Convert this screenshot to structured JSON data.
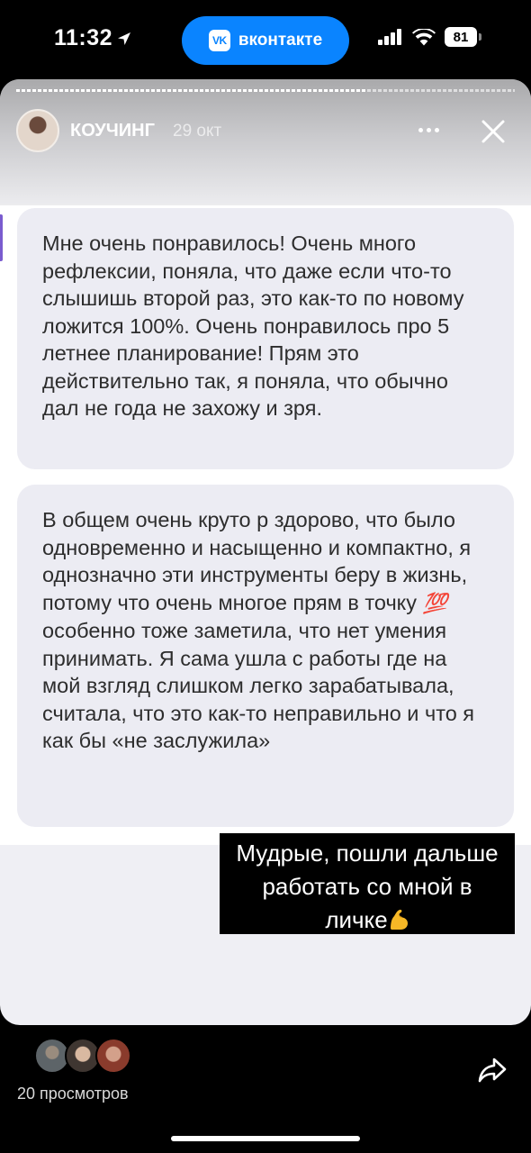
{
  "status_bar": {
    "time": "11:32",
    "app_pill_label": "вконтакте",
    "app_pill_logo": "VK",
    "battery": "81"
  },
  "story": {
    "author": "КОУЧИНГ",
    "date": "29 окт",
    "progress": 0.7,
    "messages": [
      "Мне очень понравилось! Очень много рефлексии, поняла, что даже если что-то слышишь второй раз, это как-то по новому ложится 100%. Очень понравилось про 5 летнее планирование! Прям это действительно так, я поняла, что обычно дал не года не захожу и зря.",
      "В общем очень круто р здорово, что было одновременно и насыщенно и компактно, я однозначно эти инструменты беру в жизнь, потому что очень многое прям в точку"
    ],
    "message_2_emoji": "💯",
    "message_2_tail": "особенно тоже заметила, что нет умения принимать. Я сама ушла с работы где на мой взгляд слишком легко зарабатывала, считала, что это как-то неправильно и что я как бы «не заслужила»",
    "caption_line_1": "Мудрые, пошли дальше",
    "caption_line_2": "работать со мной в",
    "caption_line_3": "личке",
    "caption_emoji": "💪"
  },
  "footer": {
    "views": "20 просмотров"
  },
  "colors": {
    "pill": "#0a84ff",
    "bubble": "#ececf3",
    "caption_bg": "#000000"
  },
  "icons": [
    "location-arrow-icon",
    "vk-logo-icon",
    "signal-icon",
    "wifi-icon",
    "battery-icon",
    "more-icon",
    "close-icon",
    "share-icon"
  ]
}
